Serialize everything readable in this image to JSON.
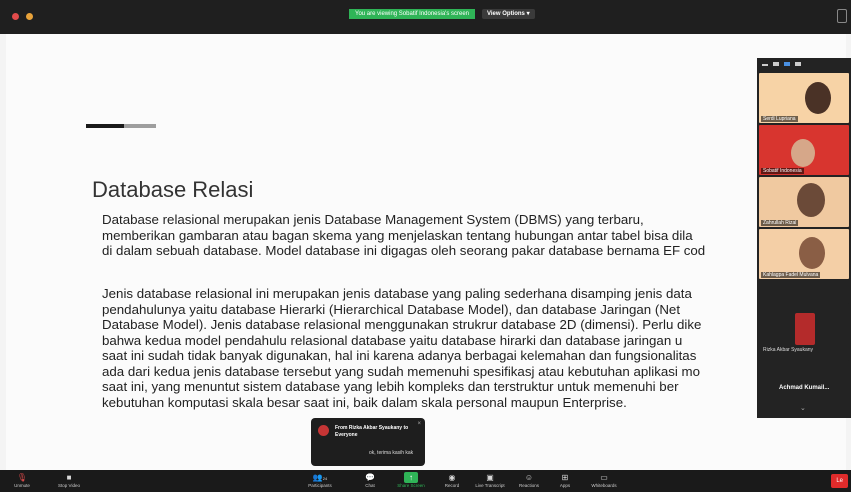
{
  "topbar": {
    "banner": "You are viewing Sobatif Indonesia's screen",
    "view_options": "View Options ▾"
  },
  "slide": {
    "title": "Database Relasi",
    "paragraph1": [
      "Database relasional merupakan jenis Database Management System (DBMS) yang terbaru,",
      "memberikan gambaran atau bagan skema yang menjelaskan tentang hubungan antar tabel bisa dila",
      "di dalam sebuah database. Model database ini digagas  oleh seorang pakar database bernama EF cod"
    ],
    "paragraph2": [
      "Jenis database relasional ini merupakan jenis database yang paling sederhana disamping jenis data",
      "pendahulunya yaitu database Hierarki (Hierarchical Database Model), dan database Jaringan (Net",
      "Database Model). Jenis database relasional menggunakan strukrur database 2D (dimensi). Perlu dike",
      "bahwa kedua model pendahulu relasional database yaitu  database hirarki dan database jaringan u",
      "saat ini sudah tidak banyak digunakan, hal ini karena adanya berbagai kelemahan dan fungsionalitas",
      "ada dari kedua jenis database tersebut yang sudah memenuhi spesifikasj atau kebutuhan aplikasi mo",
      "saat ini, yang menuntut sistem database yang lebih kompleks dan terstruktur untuk memenuhi ber",
      "kebutuhan komputasi skala besar saat ini, baik dalam skala personal maupun Enterprise."
    ]
  },
  "gallery": {
    "participants": [
      {
        "name": "Serdi Lupriana"
      },
      {
        "name": "Sobatif Indonesia"
      },
      {
        "name": "Zahrullah Rizal"
      },
      {
        "name": "Kahlagpa Fadel Mulvana"
      },
      {
        "name": "Rizka Akbar Syaukany"
      }
    ],
    "more_label": "Achmad Kumail..."
  },
  "chat_popup": {
    "from": "From Rizka Akbar Syaukany to Everyone",
    "message": "ok, terima kasih kak",
    "close": "×"
  },
  "toolbar": {
    "unmute": "Unmute",
    "stop_video": "Stop Video",
    "participants": "Participants",
    "participants_count": "24",
    "chat": "Chat",
    "share_screen": "Share Screen",
    "record": "Record",
    "live_transcript": "Live Transcript",
    "reactions": "Reactions",
    "apps": "Apps",
    "whiteboards": "Whiteboards",
    "leave": "Le"
  },
  "colors": {
    "share_green": "#2fb457",
    "leave_red": "#e02b2b",
    "accent_dark": "#1a1a1a",
    "accent_gray": "#9e9e9e"
  }
}
